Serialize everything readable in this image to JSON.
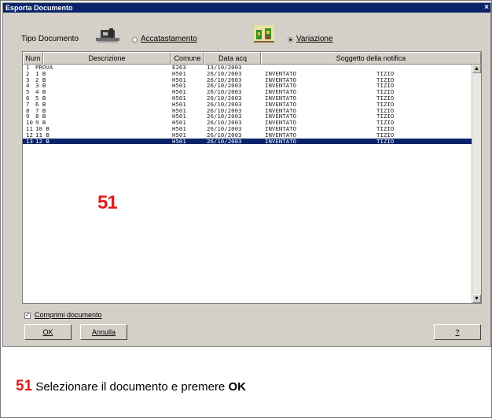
{
  "window": {
    "title": "Esporta Documento",
    "close_glyph": "×"
  },
  "tipo": {
    "label": "Tipo Documento",
    "option_accatastamento": "Accatastamento",
    "option_variazione": "Variazione",
    "selected": "Variazione"
  },
  "columns": [
    "Num",
    "Descrizione",
    "Comune",
    "Data acq",
    "Soggetto della notifica"
  ],
  "rows": [
    {
      "num": "1",
      "descr": "PROVA",
      "comune": "E263",
      "data": "13/10/2003",
      "sogg1": "",
      "sogg2": ""
    },
    {
      "num": "2",
      "descr": "1 B",
      "comune": "H501",
      "data": "26/10/2003",
      "sogg1": "INVENTATO",
      "sogg2": "TIZIO"
    },
    {
      "num": "3",
      "descr": "2 B",
      "comune": "H501",
      "data": "26/10/2003",
      "sogg1": "INVENTATO",
      "sogg2": "TIZIO"
    },
    {
      "num": "4",
      "descr": "3 B",
      "comune": "H501",
      "data": "26/10/2003",
      "sogg1": "INVENTATO",
      "sogg2": "TIZIO"
    },
    {
      "num": "5",
      "descr": "4 B",
      "comune": "H501",
      "data": "26/10/2003",
      "sogg1": "INVENTATO",
      "sogg2": "TIZIO"
    },
    {
      "num": "6",
      "descr": "5 B",
      "comune": "H501",
      "data": "26/10/2003",
      "sogg1": "INVENTATO",
      "sogg2": "TIZIO"
    },
    {
      "num": "7",
      "descr": "6 B",
      "comune": "H501",
      "data": "26/10/2003",
      "sogg1": "INVENTATO",
      "sogg2": "TIZIO"
    },
    {
      "num": "8",
      "descr": "7 B",
      "comune": "H501",
      "data": "26/10/2003",
      "sogg1": "INVENTATO",
      "sogg2": "TIZIO"
    },
    {
      "num": "9",
      "descr": "8 B",
      "comune": "H501",
      "data": "26/10/2003",
      "sogg1": "INVENTATO",
      "sogg2": "TIZIO"
    },
    {
      "num": "10",
      "descr": "9 B",
      "comune": "H501",
      "data": "26/10/2003",
      "sogg1": "INVENTATO",
      "sogg2": "TIZIO"
    },
    {
      "num": "11",
      "descr": "10 B",
      "comune": "H501",
      "data": "26/10/2003",
      "sogg1": "INVENTATO",
      "sogg2": "TIZIO"
    },
    {
      "num": "12",
      "descr": "11 B",
      "comune": "H501",
      "data": "26/10/2003",
      "sogg1": "INVENTATO",
      "sogg2": "TIZIO"
    },
    {
      "num": "13",
      "descr": "12 B",
      "comune": "H501",
      "data": "26/10/2003",
      "sogg1": "INVENTATO",
      "sogg2": "TIZIO"
    }
  ],
  "selected_row": 13,
  "step_marker": "51",
  "options": {
    "comprimi_label": "Comprimi documento",
    "comprimi_checked": true
  },
  "buttons": {
    "ok": "OK",
    "annulla": "Annulla",
    "help": "?"
  },
  "caption": {
    "number": "51",
    "text": "Selezionare il documento e premere",
    "bold": "OK"
  },
  "colors": {
    "selection": "#0a246a",
    "marker_red": "#e31b1b",
    "dialog_bg": "#d4d0c8"
  },
  "icons": {
    "accatastamento": "building-accatastamento-icon",
    "variazione": "house-variazione-icon"
  }
}
